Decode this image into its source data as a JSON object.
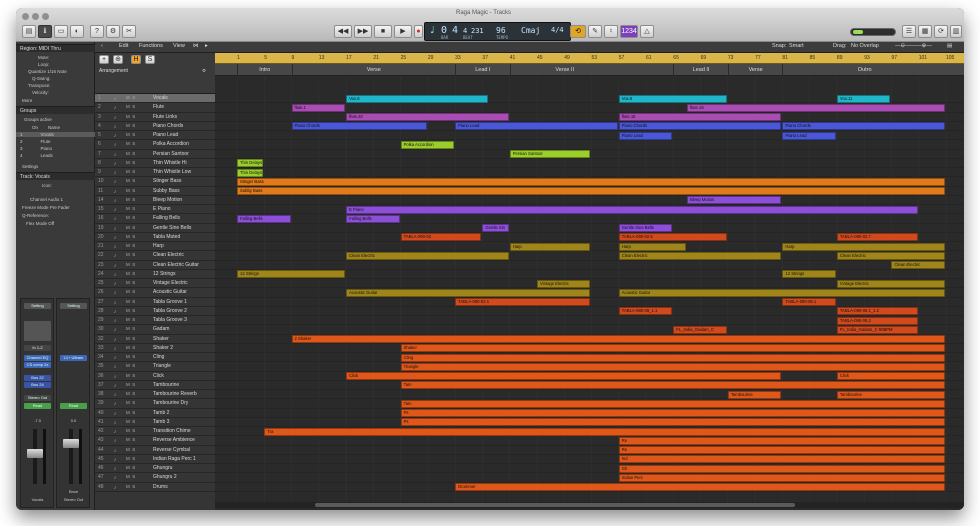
{
  "window": {
    "title": "Raga Magic - Tracks"
  },
  "lcd": {
    "bar": "0",
    "beat": "4",
    "div": "4",
    "tick": "231",
    "tempo": "96",
    "key": "Cmaj",
    "signature": "4/4",
    "bar_label": "BAR",
    "beat_label": "BEAT",
    "tempo_label": "TEMPO"
  },
  "toolbar": {
    "tuner_label": "1234",
    "count_label": "ǝ",
    "snap_label": "Snap:",
    "snap_value": "Smart",
    "drag_label": "Drag:",
    "drag_value": "No Overlap"
  },
  "edit_menu": {
    "edit": "Edit",
    "functions": "Functions",
    "view": "View"
  },
  "inspector": {
    "region_header": "Region: MIDI Thru",
    "rows": [
      "Mute:",
      "Loop:",
      "Quantize  1/16 Note",
      "Q-Swing:",
      "Transpose:",
      "Velocity:"
    ],
    "more": "More",
    "groups_header": "Groups",
    "groups_active": "Groups active",
    "group_cols": [
      "On",
      "Name"
    ],
    "groups": [
      {
        "num": "1",
        "name": "Vocals"
      },
      {
        "num": "2",
        "name": "Flute"
      },
      {
        "num": "3",
        "name": "Piano"
      },
      {
        "num": "4",
        "name": "Leads"
      }
    ],
    "settings": "Settings",
    "track_header": "Track: Vocals",
    "track_rows": [
      "Icon:",
      "Channel  Audio 1",
      "Freeze Mode  Pre Fader",
      "Q-Reference:",
      "Flex Mode  Off"
    ],
    "strip1": {
      "setting": "Setting",
      "in": "In 1-2",
      "eq": "Channel EQ",
      "comp": "CS comp 2x",
      "bus1": "Bus 22",
      "bus2": "Bus 24",
      "output": "Stereo Out",
      "read": "Read",
      "value": "-7.0",
      "name": "Vocals"
    },
    "strip2": {
      "setting": "Setting",
      "slot": "L1+ Ultram",
      "read": "Read",
      "value": "0.0",
      "name": "Stereo Out",
      "bounce": "Bnce"
    }
  },
  "arrangement": {
    "label": "Arrangement",
    "sections": [
      {
        "name": "Intro",
        "start": 1,
        "end": 9
      },
      {
        "name": "Verse",
        "start": 9,
        "end": 33
      },
      {
        "name": "Lead I",
        "start": 33,
        "end": 41
      },
      {
        "name": "Verse II",
        "start": 41,
        "end": 57
      },
      {
        "name": "Lead II",
        "start": 65,
        "end": 73
      },
      {
        "name": "Verse",
        "start": 73,
        "end": 81
      },
      {
        "name": "Outro",
        "start": 81,
        "end": 105
      }
    ]
  },
  "ruler": {
    "ticks": [
      "1",
      "5",
      "9",
      "13",
      "17",
      "21",
      "25",
      "29",
      "33",
      "37",
      "41",
      "45",
      "49",
      "53",
      "57",
      "61",
      "65",
      "69",
      "73",
      "77",
      "81",
      "85",
      "89",
      "93",
      "97",
      "101",
      "105"
    ]
  },
  "tracks": [
    {
      "num": "1",
      "name": "Vocals",
      "color": "#1fb6c9"
    },
    {
      "num": "2",
      "name": "Flute",
      "color": "#a94cb3"
    },
    {
      "num": "3",
      "name": "Flute Links",
      "color": "#a94cb3"
    },
    {
      "num": "4",
      "name": "Piano Chords",
      "color": "#4a57d6"
    },
    {
      "num": "5",
      "name": "Piano Lead",
      "color": "#4a57d6"
    },
    {
      "num": "6",
      "name": "Polka Accordion",
      "color": "#9bce2a"
    },
    {
      "num": "7",
      "name": "Persian Santoor",
      "color": "#9bce2a"
    },
    {
      "num": "8",
      "name": "Thin Whistle Hi",
      "color": "#9bce2a"
    },
    {
      "num": "9",
      "name": "Thin Whistle Low",
      "color": "#9bce2a"
    },
    {
      "num": "10",
      "name": "Stinger Bass",
      "color": "#e07a1a"
    },
    {
      "num": "11",
      "name": "Subby Bass",
      "color": "#e07a1a"
    },
    {
      "num": "14",
      "name": "Bleep Motion",
      "color": "#8d4fd8"
    },
    {
      "num": "15",
      "name": "E Piano",
      "color": "#8d4fd8"
    },
    {
      "num": "16",
      "name": "Falling Bells",
      "color": "#8d4fd8"
    },
    {
      "num": "19",
      "name": "Gentle Sine Bells",
      "color": "#8d4fd8"
    },
    {
      "num": "20",
      "name": "Tabla Muted",
      "color": "#d04a1d"
    },
    {
      "num": "21",
      "name": "Harp",
      "color": "#a0861a"
    },
    {
      "num": "22",
      "name": "Clean Electric",
      "color": "#a0861a"
    },
    {
      "num": "23",
      "name": "Clean Electric Guitar",
      "color": "#a0861a"
    },
    {
      "num": "24",
      "name": "12 Strings",
      "color": "#a0861a"
    },
    {
      "num": "25",
      "name": "Vintage Electric",
      "color": "#a0861a"
    },
    {
      "num": "26",
      "name": "Acoustic Guitar",
      "color": "#a0861a"
    },
    {
      "num": "27",
      "name": "Tabla Groove 1",
      "color": "#d04a1d"
    },
    {
      "num": "28",
      "name": "Tabla Groove 2",
      "color": "#d04a1d"
    },
    {
      "num": "29",
      "name": "Tabla Groove 3",
      "color": "#d04a1d"
    },
    {
      "num": "30",
      "name": "Gadam",
      "color": "#d04a1d"
    },
    {
      "num": "32",
      "name": "Shaker",
      "color": "#e0571a"
    },
    {
      "num": "33",
      "name": "Shaker 2",
      "color": "#e0571a"
    },
    {
      "num": "34",
      "name": "Cling",
      "color": "#e0571a"
    },
    {
      "num": "35",
      "name": "Triangle",
      "color": "#e0571a"
    },
    {
      "num": "36",
      "name": "Click",
      "color": "#e0571a"
    },
    {
      "num": "37",
      "name": "Tambourine",
      "color": "#e0571a"
    },
    {
      "num": "38",
      "name": "Tambourine Reverb",
      "color": "#e0571a"
    },
    {
      "num": "39",
      "name": "Tambourine Dry",
      "color": "#e0571a"
    },
    {
      "num": "40",
      "name": "Tamb 2",
      "color": "#e0571a"
    },
    {
      "num": "41",
      "name": "Tamb 3",
      "color": "#e0571a"
    },
    {
      "num": "42",
      "name": "Transition Chime",
      "color": "#e0571a"
    },
    {
      "num": "43",
      "name": "Reverse Ambience",
      "color": "#e0571a"
    },
    {
      "num": "44",
      "name": "Reverse Cymbal",
      "color": "#e0571a"
    },
    {
      "num": "45",
      "name": "Indian Raga Perc 1",
      "color": "#e0571a"
    },
    {
      "num": "46",
      "name": "Ghungru",
      "color": "#e0571a"
    },
    {
      "num": "47",
      "name": "Ghungru 2",
      "color": "#e0571a"
    },
    {
      "num": "48",
      "name": "Drums",
      "color": "#e0571a"
    }
  ],
  "regions": [
    {
      "t": 0,
      "s": 17,
      "e": 38,
      "label": "Vox.6"
    },
    {
      "t": 0,
      "s": 57,
      "e": 73,
      "label": "Vox.8"
    },
    {
      "t": 0,
      "s": 89,
      "e": 97,
      "label": "Vox.11"
    },
    {
      "t": 1,
      "s": 9,
      "e": 17,
      "label": "flute.1"
    },
    {
      "t": 1,
      "s": 67,
      "e": 105,
      "label": "flute.16"
    },
    {
      "t": 2,
      "s": 17,
      "e": 41,
      "label": "flute.20"
    },
    {
      "t": 2,
      "s": 57,
      "e": 81,
      "label": "flute.15"
    },
    {
      "t": 3,
      "s": 9,
      "e": 29,
      "label": "Piano Chords"
    },
    {
      "t": 3,
      "s": 33,
      "e": 57,
      "label": "Piano Lead"
    },
    {
      "t": 3,
      "s": 57,
      "e": 81,
      "label": "Piano Chords"
    },
    {
      "t": 3,
      "s": 81,
      "e": 105,
      "label": "Piano Chords"
    },
    {
      "t": 4,
      "s": 57,
      "e": 65,
      "label": "Piano Lead"
    },
    {
      "t": 4,
      "s": 81,
      "e": 89,
      "label": "Piano Lead"
    },
    {
      "t": 5,
      "s": 25,
      "e": 33,
      "label": "Polka Accordion"
    },
    {
      "t": 6,
      "s": 41,
      "e": 53,
      "label": "Persian Santoor"
    },
    {
      "t": 7,
      "s": 1,
      "e": 5,
      "label": "Thin Delays"
    },
    {
      "t": 8,
      "s": 1,
      "e": 5,
      "label": "Thin Delays"
    },
    {
      "t": 9,
      "s": 1,
      "e": 105,
      "label": "Stinger Bass"
    },
    {
      "t": 10,
      "s": 1,
      "e": 105,
      "label": "Subby Bass"
    },
    {
      "t": 11,
      "s": 67,
      "e": 81,
      "label": "Bleep Motion"
    },
    {
      "t": 12,
      "s": 17,
      "e": 101,
      "label": "E Piano"
    },
    {
      "t": 13,
      "s": 1,
      "e": 9,
      "label": "Falling Bells"
    },
    {
      "t": 13,
      "s": 17,
      "e": 25,
      "label": "Falling Bells"
    },
    {
      "t": 14,
      "s": 37,
      "e": 41,
      "label": "Gentle Sin"
    },
    {
      "t": 14,
      "s": 57,
      "e": 65,
      "label": "Gentle Sine Bells"
    },
    {
      "t": 15,
      "s": 25,
      "e": 37,
      "label": "TABLA-090-02"
    },
    {
      "t": 15,
      "s": 57,
      "e": 73,
      "label": "TABLA-090-02.5"
    },
    {
      "t": 15,
      "s": 89,
      "e": 101,
      "label": "TABLA-090-02.7"
    },
    {
      "t": 16,
      "s": 41,
      "e": 53,
      "label": "Harp"
    },
    {
      "t": 16,
      "s": 57,
      "e": 67,
      "label": "Harp"
    },
    {
      "t": 16,
      "s": 81,
      "e": 105,
      "label": "Harp"
    },
    {
      "t": 17,
      "s": 17,
      "e": 41,
      "label": "Clean Electric"
    },
    {
      "t": 17,
      "s": 57,
      "e": 81,
      "label": "Clean Electric"
    },
    {
      "t": 17,
      "s": 89,
      "e": 105,
      "label": "Clean Electric"
    },
    {
      "t": 18,
      "s": 97,
      "e": 105,
      "label": "Clean Electric"
    },
    {
      "t": 19,
      "s": 1,
      "e": 17,
      "label": "12 Strings"
    },
    {
      "t": 19,
      "s": 81,
      "e": 89,
      "label": "12 Strings"
    },
    {
      "t": 20,
      "s": 45,
      "e": 53,
      "label": "Vintage Electric"
    },
    {
      "t": 20,
      "s": 89,
      "e": 105,
      "label": "Vintage Electric"
    },
    {
      "t": 21,
      "s": 17,
      "e": 53,
      "label": "Acoustic Guitar"
    },
    {
      "t": 21,
      "s": 57,
      "e": 105,
      "label": "Acoustic Guitar"
    },
    {
      "t": 22,
      "s": 33,
      "e": 53,
      "label": "TABLA-090-02.1"
    },
    {
      "t": 22,
      "s": 81,
      "e": 89,
      "label": "TABLA-090-06.1"
    },
    {
      "t": 23,
      "s": 57,
      "e": 65,
      "label": "TABLA-080-06_1.1"
    },
    {
      "t": 23,
      "s": 89,
      "e": 101,
      "label": "TABLA-090-06.1_1.2"
    },
    {
      "t": 24,
      "s": 89,
      "e": 101,
      "label": "TABLA-090-06.2"
    },
    {
      "t": 25,
      "s": 65,
      "e": 73,
      "label": "FL_India_Gadam_C"
    },
    {
      "t": 25,
      "s": 89,
      "e": 101,
      "label": "FL_India_Gadam_C 90BPM"
    },
    {
      "t": 26,
      "s": 9,
      "e": 105,
      "label": "2 Shaker"
    },
    {
      "t": 27,
      "s": 25,
      "e": 105,
      "label": "Shaker"
    },
    {
      "t": 28,
      "s": 25,
      "e": 105,
      "label": "Cling"
    },
    {
      "t": 29,
      "s": 25,
      "e": 105,
      "label": "Triangle"
    },
    {
      "t": 30,
      "s": 17,
      "e": 81,
      "label": "Click"
    },
    {
      "t": 30,
      "s": 89,
      "e": 105,
      "label": "Click"
    },
    {
      "t": 31,
      "s": 25,
      "e": 105,
      "label": "Tam"
    },
    {
      "t": 32,
      "s": 73,
      "e": 81,
      "label": "Tambourine"
    },
    {
      "t": 32,
      "s": 89,
      "e": 105,
      "label": "Tambourine"
    },
    {
      "t": 33,
      "s": 25,
      "e": 105,
      "label": "Tam"
    },
    {
      "t": 34,
      "s": 25,
      "e": 105,
      "label": "Ps"
    },
    {
      "t": 35,
      "s": 25,
      "e": 105,
      "label": "Ps"
    },
    {
      "t": 36,
      "s": 5,
      "e": 105,
      "label": "Tra"
    },
    {
      "t": 37,
      "s": 57,
      "e": 105,
      "label": "Re"
    },
    {
      "t": 38,
      "s": 57,
      "e": 105,
      "label": "Re"
    },
    {
      "t": 39,
      "s": 57,
      "e": 105,
      "label": "Ind"
    },
    {
      "t": 40,
      "s": 57,
      "e": 105,
      "label": "Gh"
    },
    {
      "t": 41,
      "s": 57,
      "e": 105,
      "label": "Indian Perc"
    },
    {
      "t": 42,
      "s": 33,
      "e": 105,
      "label": "Drummer"
    }
  ]
}
